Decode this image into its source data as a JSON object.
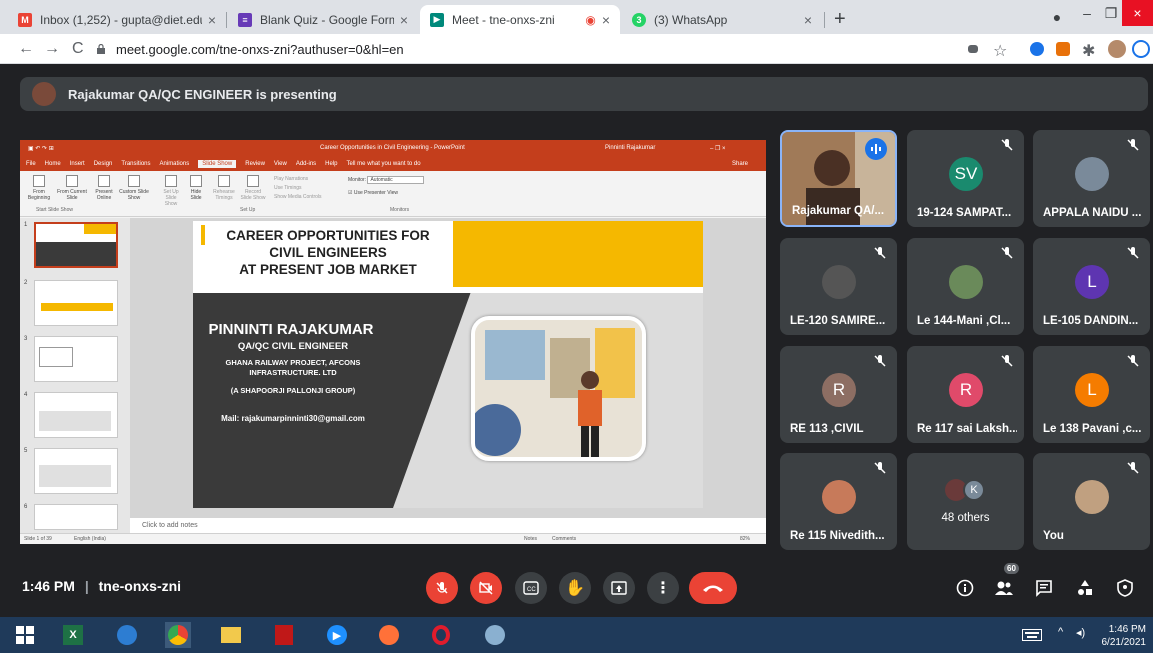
{
  "browser": {
    "tabs": [
      {
        "title": "Inbox (1,252) - gupta@diet.edu.i",
        "favicon": "gmail-icon",
        "color": "#ea4335"
      },
      {
        "title": "Blank Quiz - Google Forms",
        "favicon": "forms-icon",
        "color": "#673ab7"
      },
      {
        "title": "Meet - tne-onxs-zni",
        "favicon": "meet-icon",
        "color": "#00897b"
      },
      {
        "title": "(3) WhatsApp",
        "favicon": "whatsapp-icon",
        "color": "#25d366"
      }
    ],
    "url": "meet.google.com/tne-onxs-zni?authuser=0&hl=en"
  },
  "banner": {
    "text": "Rajakumar QA/QC ENGINEER is presenting"
  },
  "powerpoint": {
    "title": "Career Opportunities in Civil Engineering  -  PowerPoint",
    "user": "Pinninti Rajakumar",
    "ribbon_tabs": [
      "File",
      "Home",
      "Insert",
      "Design",
      "Transitions",
      "Animations",
      "Slide Show",
      "Review",
      "View",
      "Add-ins",
      "Help",
      "Tell me what you want to do"
    ],
    "share": "Share",
    "ribbon": {
      "from_beginning": "From Beginning",
      "from_current": "From Current Slide",
      "present_online": "Present Online",
      "custom_show": "Custom Slide Show",
      "setup": "Set Up Slide Show",
      "hide": "Hide Slide",
      "rehearse": "Rehearse Timings",
      "record": "Record Slide Show",
      "play_narrations": "Play Narrations",
      "use_timings": "Use Timings",
      "show_media": "Show Media Controls",
      "monitor_label": "Monitor:",
      "monitor_value": "Automatic",
      "presenter_view": "Use Presenter View",
      "group_start": "Start Slide Show",
      "group_setup": "Set Up",
      "group_monitors": "Monitors"
    },
    "thumb_numbers": [
      "1",
      "2",
      "3",
      "4",
      "5",
      "6"
    ],
    "notes_placeholder": "Click to add notes",
    "status_left": "Slide 1 of 39",
    "status_lang": "English (India)",
    "status_notes": "Notes",
    "status_comments": "Comments",
    "zoom": "82%"
  },
  "slide": {
    "heading_1": "CAREER OPPORTUNITIES FOR",
    "heading_2": "CIVIL ENGINEERS",
    "heading_3": "AT PRESENT JOB MARKET",
    "name": "PINNINTI RAJAKUMAR",
    "role": "QA/QC CIVIL ENGINEER",
    "line_1": "GHANA RAILWAY PROJECT, AFCONS",
    "line_2": "INFRASTRUCTURE. LTD",
    "line_3": "(A SHAPOORJI PALLONJI GROUP)",
    "mail": "Mail: rajakumarpinninti30@gmail.com"
  },
  "participants": [
    {
      "name": "Rajakumar QA/...",
      "type": "video"
    },
    {
      "name": "19-124 SAMPAT...",
      "initials": "SV",
      "color": "#1a8a6e"
    },
    {
      "name": "APPALA NAIDU ...",
      "type": "photo",
      "color": "#7a8a9a"
    },
    {
      "name": "LE-120 SAMIRE...",
      "type": "photo",
      "color": "#555555"
    },
    {
      "name": "Le 144-Mani ,Cl...",
      "type": "photo",
      "color": "#6a8a5a"
    },
    {
      "name": "LE-105 DANDIN...",
      "initials": "L",
      "color": "#5e35b1"
    },
    {
      "name": "RE 113 ,CIVIL",
      "initials": "R",
      "color": "#8d6e63"
    },
    {
      "name": "Re 117 sai Laksh...",
      "initials": "R",
      "color": "#e04a6a"
    },
    {
      "name": "Le 138 Pavani ,c...",
      "initials": "L",
      "color": "#f57c00"
    },
    {
      "name": "Re 115 Nivedith...",
      "type": "photo",
      "color": "#c77a5a"
    },
    {
      "name": "48 others",
      "initials": "K",
      "color": "#7a8a99"
    },
    {
      "name": "You",
      "type": "photo",
      "color": "#c0a080"
    }
  ],
  "callbar": {
    "time": "1:46 PM",
    "meeting_code": "tne-onxs-zni",
    "participant_count": "60"
  },
  "taskbar": {
    "time": "1:46 PM",
    "date": "6/21/2021"
  },
  "colors": {
    "accent_red": "#ea4335",
    "meet_bg": "#202124",
    "tile_bg": "#3c4043",
    "ppt_red": "#c43e1c",
    "slide_yellow": "#f5b800"
  }
}
